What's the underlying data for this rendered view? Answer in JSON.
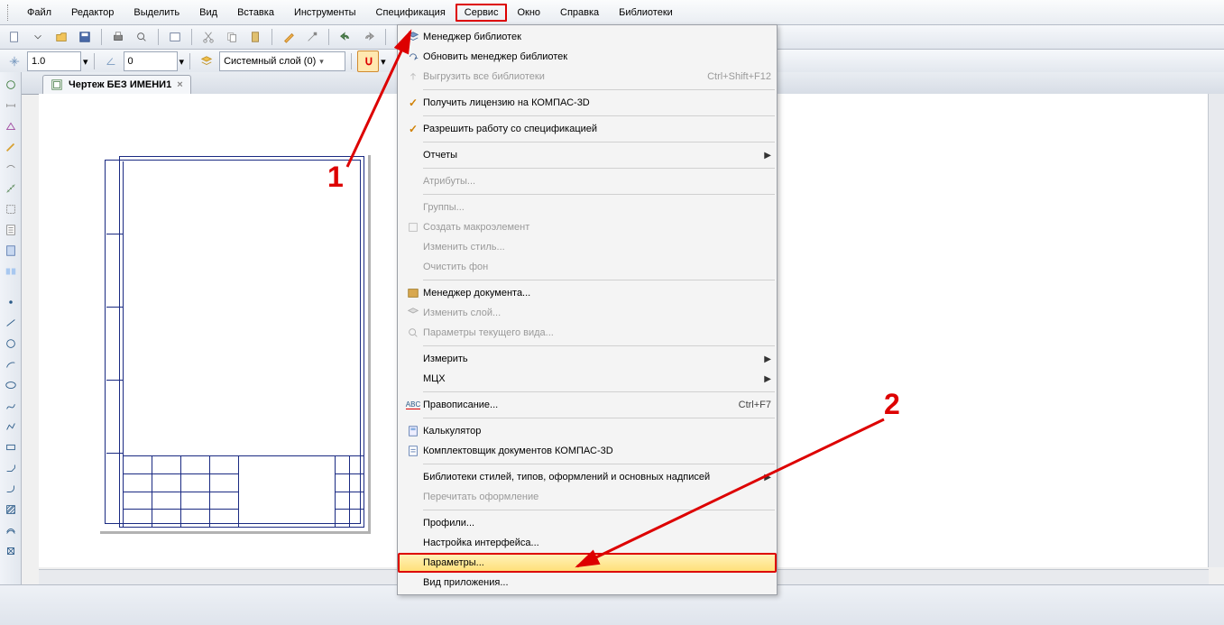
{
  "menubar": {
    "items": [
      {
        "label": "Файл",
        "u": 0
      },
      {
        "label": "Редактор",
        "u": 0
      },
      {
        "label": "Выделить",
        "u": 1
      },
      {
        "label": "Вид",
        "u": 0
      },
      {
        "label": "Вставка",
        "u": 3
      },
      {
        "label": "Инструменты",
        "u": 0
      },
      {
        "label": "Спецификация",
        "u": 3
      },
      {
        "label": "Сервис",
        "u": 0,
        "highlight": true
      },
      {
        "label": "Окно",
        "u": 0
      },
      {
        "label": "Справка",
        "u": 0
      },
      {
        "label": "Библиотеки",
        "u": 0
      }
    ]
  },
  "toolbar2": {
    "step_value": "1.0",
    "angle_value": "0",
    "layer_label": "Системный слой (0)"
  },
  "tabs": {
    "doc_name": "Чертеж БЕЗ ИМЕНИ1"
  },
  "dropdown": {
    "items": [
      {
        "type": "item",
        "icon": "stack",
        "label": "Менеджер библиотек"
      },
      {
        "type": "item",
        "icon": "refresh",
        "label": "Обновить менеджер библиотек"
      },
      {
        "type": "item",
        "icon": "upload",
        "label": "Выгрузить все библиотеки",
        "shortcut": "Ctrl+Shift+F12",
        "disabled": true
      },
      {
        "type": "sep"
      },
      {
        "type": "item",
        "icon": "check",
        "label": "Получить лицензию на КОМПАС-3D"
      },
      {
        "type": "sep"
      },
      {
        "type": "item",
        "icon": "check",
        "label": "Разрешить работу со спецификацией"
      },
      {
        "type": "sep"
      },
      {
        "type": "item",
        "label": "Отчеты",
        "submenu": true
      },
      {
        "type": "sep"
      },
      {
        "type": "item",
        "label": "Атрибуты...",
        "disabled": true
      },
      {
        "type": "sep"
      },
      {
        "type": "item",
        "label": "Группы...",
        "disabled": true
      },
      {
        "type": "item",
        "icon": "macro",
        "label": "Создать макроэлемент",
        "disabled": true
      },
      {
        "type": "item",
        "label": "Изменить стиль...",
        "disabled": true
      },
      {
        "type": "item",
        "label": "Очистить фон",
        "disabled": true
      },
      {
        "type": "sep"
      },
      {
        "type": "item",
        "icon": "docmgr",
        "label": "Менеджер документа..."
      },
      {
        "type": "item",
        "icon": "layer",
        "label": "Изменить слой...",
        "disabled": true
      },
      {
        "type": "item",
        "icon": "viewparam",
        "label": "Параметры текущего вида...",
        "disabled": true
      },
      {
        "type": "sep"
      },
      {
        "type": "item",
        "label": "Измерить",
        "submenu": true
      },
      {
        "type": "item",
        "label": "МЦХ",
        "submenu": true
      },
      {
        "type": "sep"
      },
      {
        "type": "item",
        "icon": "abc",
        "label": "Правописание...",
        "shortcut": "Ctrl+F7"
      },
      {
        "type": "sep"
      },
      {
        "type": "item",
        "icon": "calc",
        "label": "Калькулятор"
      },
      {
        "type": "item",
        "icon": "kit",
        "label": "Комплектовщик документов КОМПАС-3D"
      },
      {
        "type": "sep"
      },
      {
        "type": "item",
        "label": "Библиотеки стилей, типов, оформлений и основных надписей",
        "submenu": true
      },
      {
        "type": "item",
        "label": "Перечитать оформление",
        "disabled": true
      },
      {
        "type": "sep"
      },
      {
        "type": "item",
        "label": "Профили..."
      },
      {
        "type": "item",
        "label": "Настройка интерфейса..."
      },
      {
        "type": "item",
        "label": "Параметры...",
        "highlight": true
      },
      {
        "type": "item",
        "label": "Вид приложения..."
      }
    ]
  },
  "annotations": {
    "n1": "1",
    "n2": "2"
  }
}
